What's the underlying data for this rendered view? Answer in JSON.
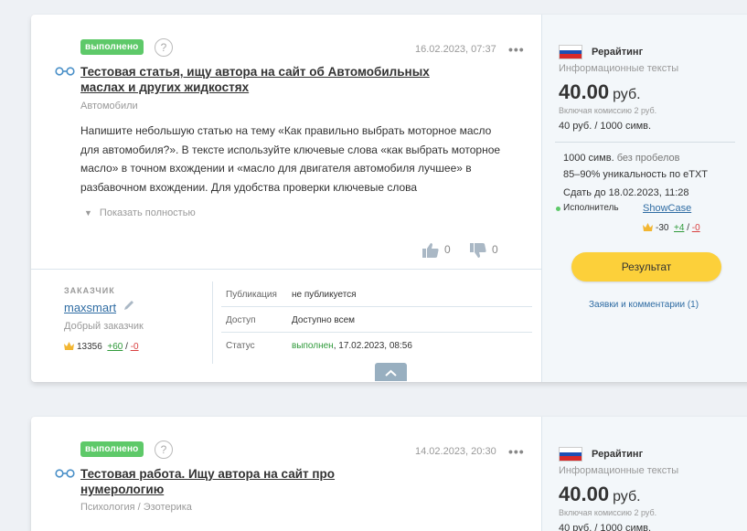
{
  "orders": [
    {
      "status": "выполнено",
      "help": "?",
      "date": "16.02.2023, 07:37",
      "more": "•••",
      "title": "Тестовая статья, ищу автора на сайт об Автомобильных маслах и других жидкостях",
      "category": "Автомобили",
      "description": "Напишите небольшую статью на тему «Как правильно выбрать моторное масло для автомобиля?». В тексте используйте ключевые слова «как выбрать моторное масло» в точном вхождении и «масло для двигателя автомобиля лучшее» в разбавочном вхождении. Для удобства проверки ключевые слова",
      "show_full": "Показать полностью",
      "likes": "0",
      "dislikes": "0",
      "client": {
        "heading": "ЗАКАЗЧИК",
        "name": "maxsmart",
        "subtitle": "Добрый заказчик",
        "rating": "13356",
        "plus": "+60",
        "sep": "/",
        "minus": "-0"
      },
      "info": [
        {
          "key": "Публикация",
          "value": "не публикуется",
          "value_extra": ""
        },
        {
          "key": "Доступ",
          "value": "Доступно всем",
          "value_extra": ""
        },
        {
          "key": "Статус",
          "value": "выполнен",
          "value_extra": ", 17.02.2023, 08:56"
        }
      ],
      "side": {
        "type": "Рерайтинг",
        "subtype": "Информационные тексты",
        "price": "40.00",
        "currency": "руб.",
        "commission": "Включая комиссию 2 руб.",
        "per_k": "40 руб. / 1000 симв.",
        "chars": "1000 симв.",
        "chars_note": "без пробелов",
        "uniq": "85–90% уникальность по eTXT",
        "deadline": "Сдать до 18.02.2023, 11:28",
        "executor_label": "Исполнитель",
        "executor_name": "ShowCase",
        "executor_rating": "-30",
        "executor_plus": "+4",
        "executor_sep": "/",
        "executor_minus": "-0",
        "result_button": "Результат",
        "comments": "Заявки и комментарии (1)"
      }
    },
    {
      "status": "выполнено",
      "help": "?",
      "date": "14.02.2023, 20:30",
      "more": "•••",
      "title": "Тестовая работа. Ищу автора на сайт про нумерологию",
      "category": "Психология / Эзотерика",
      "side": {
        "type": "Рерайтинг",
        "subtype": "Информационные тексты",
        "price": "40.00",
        "currency": "руб.",
        "commission": "Включая комиссию 2 руб.",
        "per_k": "40 руб. / 1000 симв."
      }
    }
  ],
  "colors": {
    "badge": "#5ec969",
    "link": "#2f6ca3",
    "button": "#fcd03a",
    "side_bg": "#f3f7fa"
  }
}
